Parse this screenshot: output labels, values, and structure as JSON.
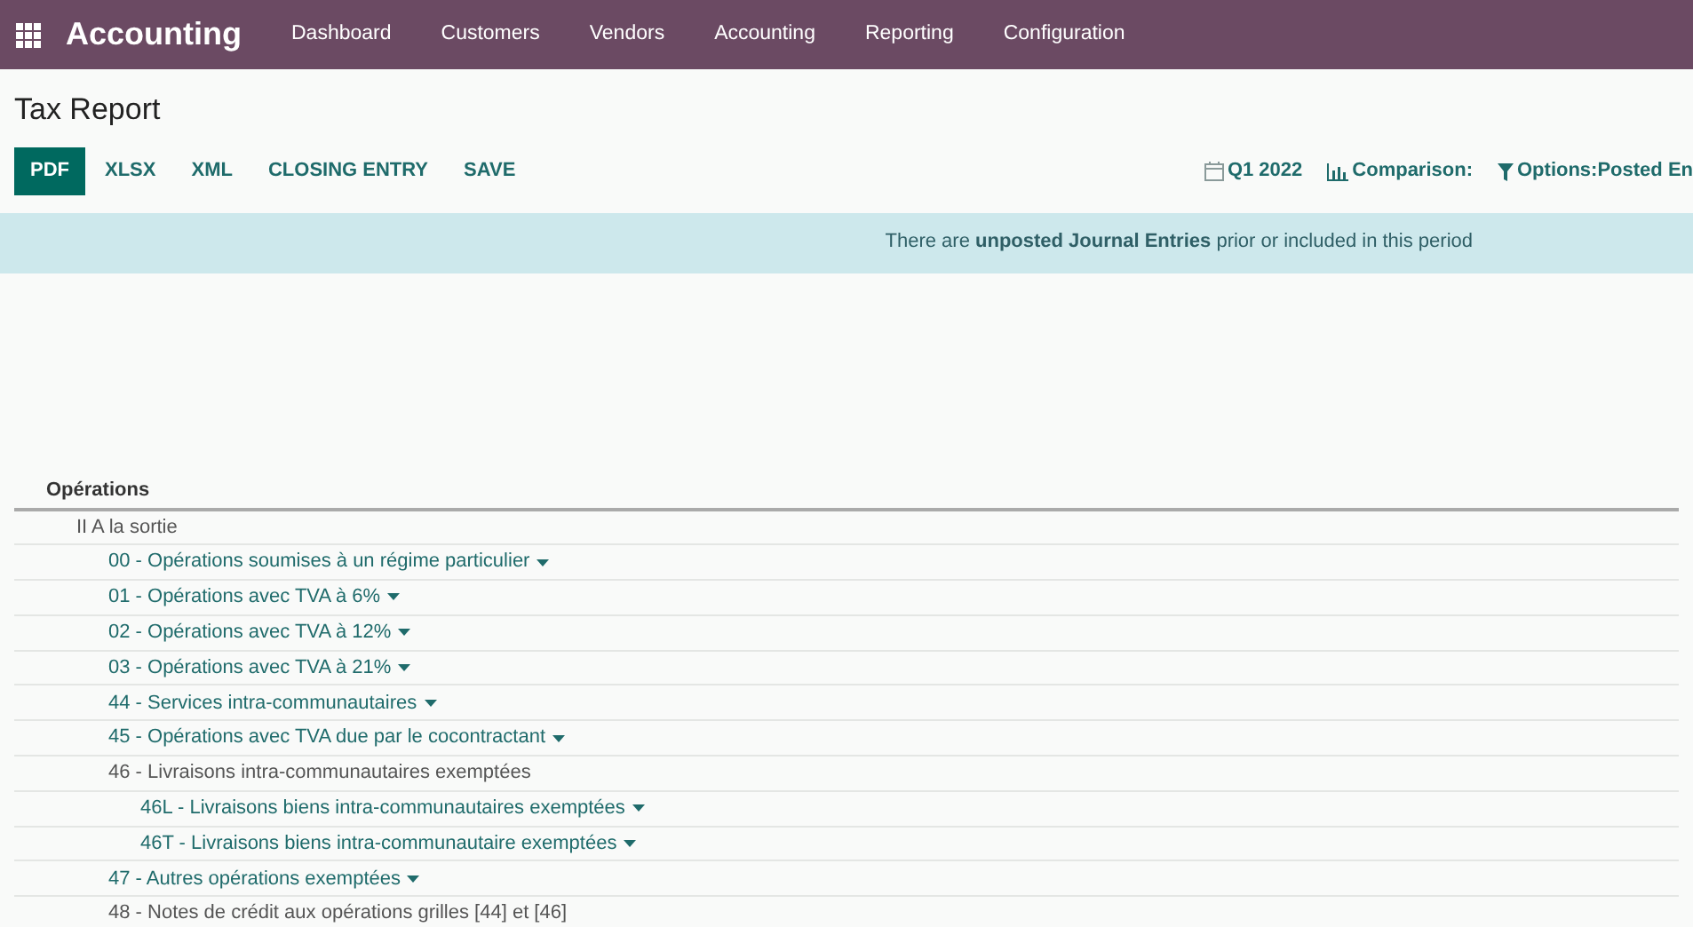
{
  "app": {
    "name": "Accounting"
  },
  "menu": [
    "Dashboard",
    "Customers",
    "Vendors",
    "Accounting",
    "Reporting",
    "Configuration"
  ],
  "page_title": "Tax Report",
  "buttons": [
    {
      "label": "PDF",
      "selected": true
    },
    {
      "label": "XLSX",
      "selected": false
    },
    {
      "label": "XML",
      "selected": false
    },
    {
      "label": "CLOSING ENTRY",
      "selected": false
    },
    {
      "label": "SAVE",
      "selected": false
    }
  ],
  "filters": [
    {
      "kind": "calendar",
      "label": "Q1 2022"
    },
    {
      "kind": "chart",
      "label": "Comparison:"
    },
    {
      "kind": "funnel",
      "label": "Options:Posted En"
    }
  ],
  "alert": "There are **unposted Journal Entries** prior or included in this period",
  "table": {
    "header": "Opérations",
    "rows": [
      {
        "label": "II A la sortie",
        "dropdown": false,
        "children": [
          {
            "label": "00 - Opérations soumises à un régime particulier",
            "dropdown": true
          },
          {
            "label": "01 - Opérations avec TVA à 6%",
            "dropdown": true
          },
          {
            "label": "02 - Opérations avec TVA à 12%",
            "dropdown": true
          },
          {
            "label": "03 - Opérations avec TVA à 21%",
            "dropdown": true
          },
          {
            "label": "44 - Services intra-communautaires",
            "dropdown": true
          },
          {
            "label": "45 - Opérations avec TVA due par le cocontractant",
            "dropdown": true
          },
          {
            "label": "46 - Livraisons intra-communautaires exemptées",
            "dropdown": false,
            "children": [
              {
                "label": "46L - Livraisons biens intra-communautaires exemptées",
                "dropdown": true
              },
              {
                "label": "46T - Livraisons biens intra-communautaire exemptées",
                "dropdown": true
              }
            ]
          },
          {
            "label": "47 - Autres opérations exemptées",
            "dropdown": true
          },
          {
            "label": "48 - Notes de crédit aux opérations grilles [44] et [46]",
            "dropdown": false
          }
        ]
      }
    ]
  }
}
